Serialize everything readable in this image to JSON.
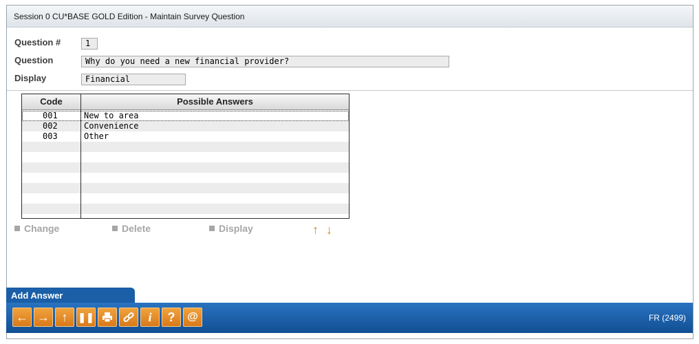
{
  "window": {
    "title": "Session 0 CU*BASE GOLD Edition - Maintain Survey Question"
  },
  "form": {
    "question_number_label": "Question #",
    "question_number_value": "1",
    "question_label": "Question",
    "question_value": "Why do you need a new financial provider?",
    "display_label": "Display",
    "display_value": "Financial"
  },
  "table": {
    "headers": [
      "Code",
      "Possible Answers"
    ],
    "rows": [
      {
        "code": "001",
        "answer": "New to area"
      },
      {
        "code": "002",
        "answer": "Convenience"
      },
      {
        "code": "003",
        "answer": "Other"
      }
    ]
  },
  "actions": {
    "change": "Change",
    "delete": "Delete",
    "display": "Display",
    "up_arrow": "↑",
    "down_arrow": "↓"
  },
  "footer": {
    "tab_label": "Add Answer",
    "screen_code": "FR (2499)",
    "icons": [
      "back-arrow-icon",
      "forward-arrow-icon",
      "up-arrow-icon",
      "pause-icon",
      "print-icon",
      "link-icon",
      "info-icon",
      "help-icon",
      "at-sign-icon"
    ]
  },
  "colors": {
    "accent": "#1a5fa8",
    "button": "#e08a25",
    "arrow": "#d7861e"
  }
}
